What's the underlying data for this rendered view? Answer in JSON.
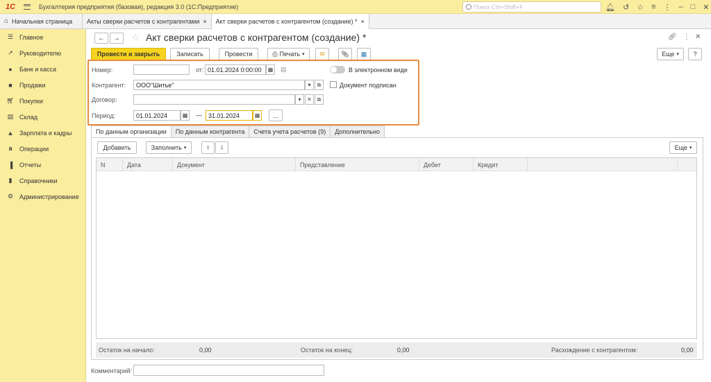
{
  "titlebar": {
    "logo": "1С",
    "app_title": "Бухгалтерия предприятия (базовая), редакция 3.0  (1С:Предприятие)",
    "search_placeholder": "Поиск Ctrl+Shift+F"
  },
  "tabs": {
    "home": "Начальная страница",
    "items": [
      {
        "label": "Акты сверки расчетов с контрагентами",
        "close": "×"
      },
      {
        "label": "Акт сверки расчетов с контрагентом (создание) *",
        "close": "×"
      }
    ]
  },
  "sidebar": {
    "items": [
      {
        "label": "Главное",
        "icon": "menu-icon"
      },
      {
        "label": "Руководителю",
        "icon": "trend-icon"
      },
      {
        "label": "Банк и касса",
        "icon": "coin-icon"
      },
      {
        "label": "Продажи",
        "icon": "bag-icon"
      },
      {
        "label": "Покупки",
        "icon": "cart-icon"
      },
      {
        "label": "Склад",
        "icon": "warehouse-icon"
      },
      {
        "label": "Зарплата и кадры",
        "icon": "person-icon"
      },
      {
        "label": "Операции",
        "icon": "operations-icon"
      },
      {
        "label": "Отчеты",
        "icon": "bar-chart-icon"
      },
      {
        "label": "Справочники",
        "icon": "book-icon"
      },
      {
        "label": "Администрирование",
        "icon": "gear-icon"
      }
    ]
  },
  "form": {
    "title": "Акт сверки расчетов с контрагентом (создание) *",
    "more_label": "Еще",
    "help_label": "?",
    "toolbar": {
      "post_close": "Провести и закрыть",
      "save": "Записать",
      "post": "Провести",
      "print": "Печать"
    },
    "fields": {
      "number_label": "Номер:",
      "number_value": "",
      "from_label": "от:",
      "date_value": "01.01.2024  0:00:00",
      "electronic_label": "В электронном виде",
      "counterparty_label": "Контрагент:",
      "counterparty_value": "ООО\"Шитье\"",
      "signed_label": "Документ подписан",
      "contract_label": "Договор:",
      "contract_value": "",
      "period_label": "Период:",
      "period_from": "01.01.2024",
      "period_dash": "—",
      "period_to": "31.01.2024",
      "period_more": "..."
    },
    "subtabs": [
      "По данным организации",
      "По данным контрагента",
      "Счета учета расчетов (9)",
      "Дополнительно"
    ],
    "panel_toolbar": {
      "add": "Добавить",
      "fill": "Заполнить",
      "more": "Еще"
    },
    "table_columns": [
      "N",
      "Дата",
      "Документ",
      "Представление",
      "Дебет",
      "Кредит"
    ],
    "totals": {
      "start_label": "Остаток на начало:",
      "start_value": "0,00",
      "end_label": "Остаток на конец:",
      "end_value": "0,00",
      "diff_label": "Расхождение с контрагентом:",
      "diff_value": "0,00"
    },
    "comment_label": "Комментарий:",
    "comment_value": ""
  },
  "colors": {
    "sidebar_bg": "#fbed9e",
    "primary_button": "#f5d31e",
    "highlight_border": "#e98a3c"
  }
}
